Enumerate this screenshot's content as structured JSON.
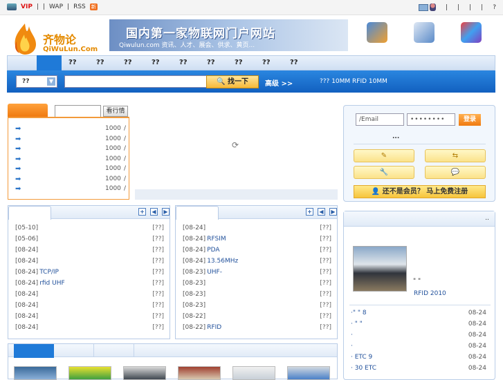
{
  "topbar": {
    "vip": "VIP",
    "sep1": "|",
    "sep2": "|",
    "wap": "WAP",
    "sep3": "|",
    "rss": "RSS",
    "new_badge": "新",
    "right_seps": [
      "|",
      "|",
      "|",
      "|"
    ],
    "help": "?"
  },
  "logo": {
    "cn": "齐物论",
    "en": "QiWuLun.Com"
  },
  "banner": {
    "title": "国内第一家物联网门户网站",
    "subtitle": "Qiwulun.com 资讯、人才、展会、供求、黄页..."
  },
  "nav": {
    "items": [
      "??",
      "??",
      "??",
      "??",
      "??",
      "??",
      "??",
      "??",
      "??"
    ]
  },
  "search": {
    "select_value": "??",
    "button": "找一下",
    "advanced": "高级 >>",
    "hot": "??? 10MM RFID  10MM"
  },
  "ranking": {
    "button": "看行情",
    "rows": [
      {
        "count": "1000",
        "slash": "/"
      },
      {
        "count": "1000",
        "slash": "/"
      },
      {
        "count": "1000",
        "slash": "/"
      },
      {
        "count": "1000",
        "slash": "/"
      },
      {
        "count": "1000",
        "slash": "/"
      },
      {
        "count": "1000",
        "slash": "/"
      },
      {
        "count": "1000",
        "slash": "/"
      }
    ]
  },
  "news_left": {
    "rows": [
      {
        "date": "[05-10]",
        "title": "",
        "tag": "[??]"
      },
      {
        "date": "[05-06]",
        "title": "",
        "tag": "[??]"
      },
      {
        "date": "[08-24]",
        "title": "",
        "tag": "[??]"
      },
      {
        "date": "[08-24]",
        "title": "",
        "tag": "[??]"
      },
      {
        "date": "[08-24]",
        "title": "TCP/IP",
        "tag": "[??]"
      },
      {
        "date": "[08-24]",
        "title": "rfid UHF",
        "tag": "[??]"
      },
      {
        "date": "[08-24]",
        "title": "",
        "tag": "[??]"
      },
      {
        "date": "[08-24]",
        "title": "",
        "tag": "[??]"
      },
      {
        "date": "[08-24]",
        "title": "",
        "tag": "[??]"
      },
      {
        "date": "[08-24]",
        "title": "",
        "tag": "[??]"
      }
    ]
  },
  "news_mid": {
    "rows": [
      {
        "date": "[08-24]",
        "title": "",
        "tag": "[??]"
      },
      {
        "date": "[08-24]",
        "title": "RFSIM",
        "tag": "[??]"
      },
      {
        "date": "[08-24]",
        "title": "PDA",
        "tag": "[??]"
      },
      {
        "date": "[08-24]",
        "title": "13.56MHz",
        "tag": "[??]"
      },
      {
        "date": "[08-23]",
        "title": "UHF-",
        "tag": "[??]"
      },
      {
        "date": "[08-23]",
        "title": "",
        "tag": "[??]"
      },
      {
        "date": "[08-23]",
        "title": "",
        "tag": "[??]"
      },
      {
        "date": "[08-23]",
        "title": "",
        "tag": "[??]"
      },
      {
        "date": "[08-22]",
        "title": "",
        "tag": "[??]"
      },
      {
        "date": "[08-22]",
        "title": "RFID",
        "tag": "[??]"
      }
    ]
  },
  "controls": {
    "plus": "+",
    "prev": "◀",
    "next": "▶"
  },
  "login": {
    "email_placeholder": "/Email",
    "password_value": "••••••••",
    "login_button": "登录",
    "dots": "...",
    "register": "还不是会员？  马上免费注册"
  },
  "right_news": {
    "more": "..",
    "caption1": "\"  \"",
    "caption2": "RFID  2010",
    "rows": [
      {
        "title": "·\"  \"    8",
        "date": "08-24"
      },
      {
        "title": "·       \"  \"",
        "date": "08-24"
      },
      {
        "title": "·",
        "date": "08-24"
      },
      {
        "title": "·",
        "date": "08-24"
      },
      {
        "title": "·       ETC  9",
        "date": "08-24"
      },
      {
        "title": "·      30 ETC",
        "date": "08-24"
      }
    ]
  },
  "colors": {
    "accent_blue": "#1f7ad8",
    "orange": "#f07a10",
    "link": "#1f4f9a"
  }
}
